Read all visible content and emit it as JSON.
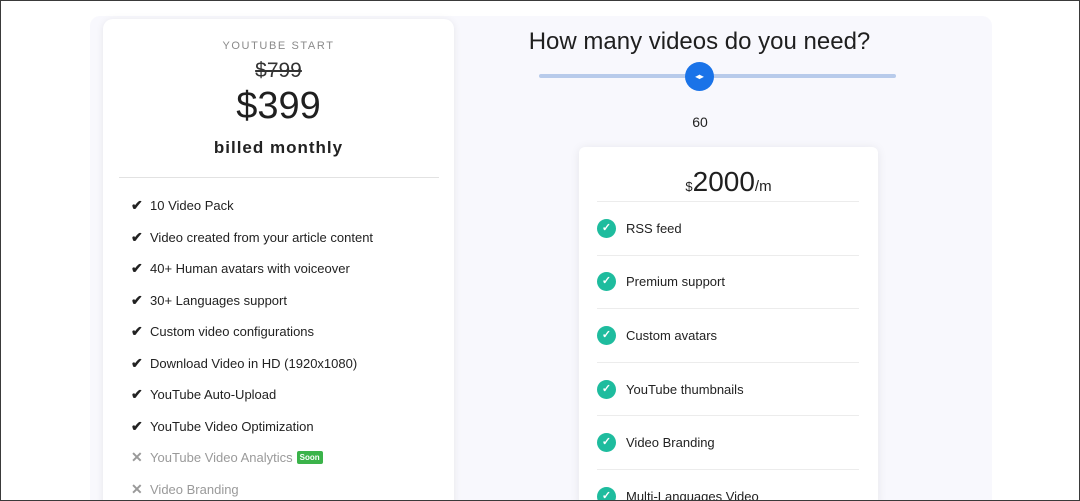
{
  "plan": {
    "name": "YOUTUBE START",
    "old_price": "$799",
    "price": "$399",
    "billing": "billed monthly",
    "features": [
      {
        "label": "10 Video Pack",
        "included": true
      },
      {
        "label": "Video created from your article content",
        "included": true
      },
      {
        "label": "40+ Human avatars with voiceover",
        "included": true
      },
      {
        "label": "30+ Languages support",
        "included": true
      },
      {
        "label": "Custom video configurations",
        "included": true
      },
      {
        "label": "Download Video in HD (1920x1080)",
        "included": true
      },
      {
        "label": "YouTube Auto-Upload",
        "included": true
      },
      {
        "label": "YouTube Video Optimization",
        "included": true
      },
      {
        "label": "YouTube Video Analytics",
        "included": false,
        "badge": "Soon"
      },
      {
        "label": "Video Branding",
        "included": false
      }
    ],
    "icons": {
      "included": "check-icon",
      "excluded": "cross-icon"
    }
  },
  "calculator": {
    "title": "How many videos do you need?",
    "slider_value": "60",
    "slider_fraction": 0.44,
    "thumb_icon": "arrows-horizontal-icon",
    "quote": {
      "currency": "$",
      "amount": "2000",
      "period": "/m",
      "features": [
        "RSS feed",
        "Premium support",
        "Custom avatars",
        "YouTube thumbnails",
        "Video Branding",
        "Multi-Languages Video"
      ]
    }
  },
  "colors": {
    "accent": "#1a73e8",
    "track": "#b8cbeb",
    "check": "#1ebc9e",
    "soon_badge": "#3bb34a",
    "section_bg": "#f8f8fd"
  }
}
